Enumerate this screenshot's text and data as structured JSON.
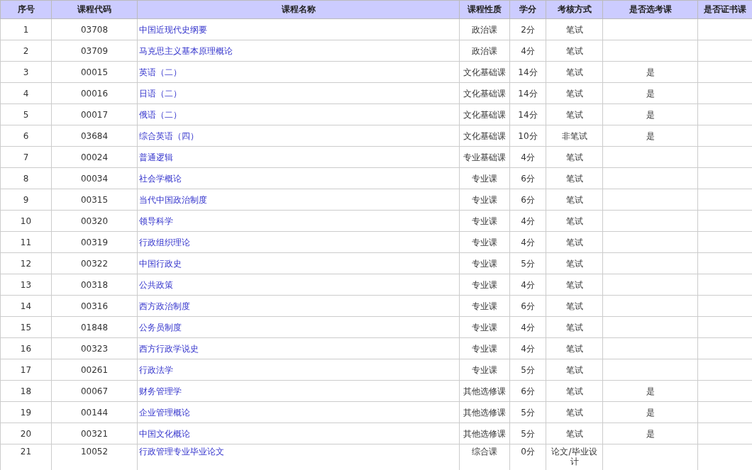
{
  "table": {
    "columns": [
      "序号",
      "课程代码",
      "课程名称",
      "课程性质",
      "学分",
      "考核方式",
      "是否选考课",
      "是否证书课"
    ],
    "rows": [
      {
        "number": "1",
        "code": "03708",
        "name": "中国近现代史纲要",
        "type": "政治课",
        "credits": "2分",
        "exam": "笔试"
      },
      {
        "number": "2",
        "code": "03709",
        "name": "马克思主义基本原理概论",
        "type": "政治课",
        "credits": "4分",
        "exam": "笔试"
      },
      {
        "number": "3",
        "code": "00015",
        "name": "英语（二）",
        "type": "文化基础课",
        "credits": "14分",
        "exam": "笔试",
        "elective": "是"
      },
      {
        "number": "4",
        "code": "00016",
        "name": "日语（二）",
        "type": "文化基础课",
        "credits": "14分",
        "exam": "笔试",
        "elective": "是"
      },
      {
        "number": "5",
        "code": "00017",
        "name": "俄语（二）",
        "type": "文化基础课",
        "credits": "14分",
        "exam": "笔试",
        "elective": "是"
      },
      {
        "number": "6",
        "code": "03684",
        "name": "综合英语（四）",
        "type": "文化基础课",
        "credits": "10分",
        "exam": "非笔试",
        "elective": "是"
      },
      {
        "number": "7",
        "code": "00024",
        "name": "普通逻辑",
        "type": "专业基础课",
        "credits": "4分",
        "exam": "笔试"
      },
      {
        "number": "8",
        "code": "00034",
        "name": "社会学概论",
        "type": "专业课",
        "credits": "6分",
        "exam": "笔试"
      },
      {
        "number": "9",
        "code": "00315",
        "name": "当代中国政治制度",
        "type": "专业课",
        "credits": "6分",
        "exam": "笔试"
      },
      {
        "number": "10",
        "code": "00320",
        "name": "领导科学",
        "type": "专业课",
        "credits": "4分",
        "exam": "笔试"
      },
      {
        "number": "11",
        "code": "00319",
        "name": "行政组织理论",
        "type": "专业课",
        "credits": "4分",
        "exam": "笔试"
      },
      {
        "number": "12",
        "code": "00322",
        "name": "中国行政史",
        "type": "专业课",
        "credits": "5分",
        "exam": "笔试"
      },
      {
        "number": "13",
        "code": "00318",
        "name": "公共政策",
        "type": "专业课",
        "credits": "4分",
        "exam": "笔试"
      },
      {
        "number": "14",
        "code": "00316",
        "name": "西方政治制度",
        "type": "专业课",
        "credits": "6分",
        "exam": "笔试"
      },
      {
        "number": "15",
        "code": "01848",
        "name": "公务员制度",
        "type": "专业课",
        "credits": "4分",
        "exam": "笔试"
      },
      {
        "number": "16",
        "code": "00323",
        "name": "西方行政学说史",
        "type": "专业课",
        "credits": "4分",
        "exam": "笔试"
      },
      {
        "number": "17",
        "code": "00261",
        "name": "行政法学",
        "type": "专业课",
        "credits": "5分",
        "exam": "笔试"
      },
      {
        "number": "18",
        "code": "00067",
        "name": "财务管理学",
        "type": "其他选修课",
        "credits": "6分",
        "exam": "笔试",
        "elective": "是"
      },
      {
        "number": "19",
        "code": "00144",
        "name": "企业管理概论",
        "type": "其他选修课",
        "credits": "5分",
        "exam": "笔试",
        "elective": "是"
      },
      {
        "number": "20",
        "code": "00321",
        "name": "中国文化概论",
        "type": "其他选修课",
        "credits": "5分",
        "exam": "笔试",
        "elective": "是"
      },
      {
        "number": "21",
        "code": "10052",
        "name": "行政管理专业毕业论文",
        "type": "综合课",
        "credits": "0分",
        "exam": "论文/毕业设计"
      }
    ]
  }
}
